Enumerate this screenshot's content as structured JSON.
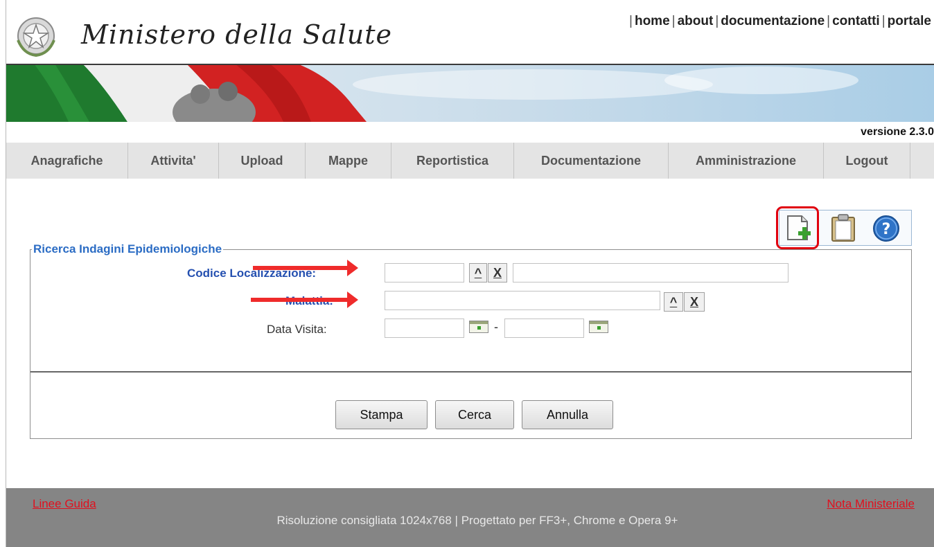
{
  "header": {
    "ministry_name": "Ministero della Salute",
    "top_links": [
      "home",
      "about",
      "documentazione",
      "contatti",
      "portale"
    ],
    "version": "versione 2.3.0"
  },
  "nav": {
    "items": [
      "Anagrafiche",
      "Attivita'",
      "Upload",
      "Mappe",
      "Reportistica",
      "Documentazione",
      "Amministrazione",
      "Logout"
    ]
  },
  "toolbar": {
    "icons": [
      "new-document-icon",
      "clipboard-icon",
      "help-icon"
    ]
  },
  "form": {
    "legend": "Ricerca Indagini Epidemiologiche",
    "codice_label": "Codice Localizzazione:",
    "malattia_label": "Malattia:",
    "data_visita_label": "Data Visita:",
    "lookup_btn": "^",
    "clear_btn": "X",
    "date_separator": "-",
    "buttons": {
      "stampa": "Stampa",
      "cerca": "Cerca",
      "annulla": "Annulla"
    }
  },
  "annotations": {
    "color": "#ef2b2b"
  },
  "footer": {
    "left_link": "Linee Guida",
    "right_link": "Nota Ministeriale",
    "info": "Risoluzione consigliata 1024x768 | Progettato per FF3+, Chrome e Opera 9+"
  }
}
